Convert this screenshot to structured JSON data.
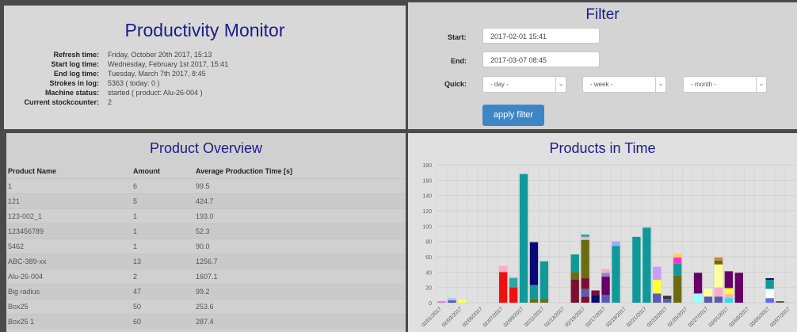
{
  "monitor": {
    "title": "Productivity Monitor",
    "rows": [
      {
        "label": "Refresh time:",
        "value": "Friday, October 20th 2017, 15:13"
      },
      {
        "label": "Start log time:",
        "value": "Wednesday, February 1st 2017, 15:41"
      },
      {
        "label": "End log time:",
        "value": "Tuesday, March 7th 2017, 8:45"
      },
      {
        "label": "Strokes in log:",
        "value": "5363 ( today: 0 )"
      },
      {
        "label": "Machine status:",
        "value": "started ( product: Alu-26-004 )"
      },
      {
        "label": "Current stockcounter:",
        "value": "2"
      }
    ]
  },
  "filter": {
    "title": "Filter",
    "start_label": "Start:",
    "start_value": "2017-02-01 15:41",
    "end_label": "End:",
    "end_value": "2017-03-07 08:45",
    "quick_label": "Quick:",
    "day": "- day -",
    "week": "- week -",
    "month": "- month -",
    "apply": "apply filter"
  },
  "products": {
    "title": "Product Overview",
    "columns": [
      "Product Name",
      "Amount",
      "Average Production Time [s]"
    ],
    "rows": [
      [
        "1",
        "6",
        "99.5"
      ],
      [
        "121",
        "5",
        "424.7"
      ],
      [
        "123-002_1",
        "1",
        "193.0"
      ],
      [
        "123456789",
        "1",
        "52.3"
      ],
      [
        "5462",
        "1",
        "90.0"
      ],
      [
        "ABC-389-xx",
        "13",
        "1256.7"
      ],
      [
        "Alu-26-004",
        "2",
        "1607.1"
      ],
      [
        "Big radius",
        "47",
        "99.2"
      ],
      [
        "Box25",
        "50",
        "253.6"
      ],
      [
        "Box25 1",
        "60",
        "287.4"
      ]
    ]
  },
  "chart_data": {
    "type": "bar",
    "stacked": true,
    "title": "Products in Time",
    "ylim": [
      0,
      180
    ],
    "yticks": [
      0,
      20,
      40,
      60,
      80,
      100,
      120,
      140,
      160,
      180
    ],
    "grid": true,
    "xticklabels": [
      "02/01/2017",
      "02/03/2017",
      "02/05/2017",
      "02/07/2017",
      "02/09/2017",
      "02/11/2017",
      "02/13/2017",
      "02/15/2017",
      "02/17/2017",
      "02/19/2017",
      "02/21/2017",
      "02/23/2017",
      "02/25/2017",
      "02/27/2017",
      "03/01/2017",
      "03/03/2017",
      "03/05/2017",
      "03/07/2017"
    ],
    "bars": [
      {
        "day": 0,
        "segments": [
          {
            "value": 2,
            "color": "#ff66ff"
          }
        ]
      },
      {
        "day": 1,
        "segments": [
          {
            "value": 3,
            "color": "#5a5ab4"
          },
          {
            "value": 3,
            "color": "#99ccff"
          }
        ]
      },
      {
        "day": 2,
        "segments": [
          {
            "value": 4,
            "color": "#ffff55"
          }
        ]
      },
      {
        "day": 6,
        "segments": [
          {
            "value": 40,
            "color": "#ee1111"
          },
          {
            "value": 8,
            "color": "#ffaacc"
          }
        ]
      },
      {
        "day": 7,
        "segments": [
          {
            "value": 20,
            "color": "#ee1111"
          },
          {
            "value": 12,
            "color": "#22aaaa"
          },
          {
            "value": 2,
            "color": "#ffaacc"
          }
        ]
      },
      {
        "day": 8,
        "segments": [
          {
            "value": 168,
            "color": "#119999"
          }
        ]
      },
      {
        "day": 9,
        "segments": [
          {
            "value": 5,
            "color": "#6b6b10"
          },
          {
            "value": 18,
            "color": "#119999"
          },
          {
            "value": 56,
            "color": "#0a0a77"
          }
        ]
      },
      {
        "day": 10,
        "segments": [
          {
            "value": 5,
            "color": "#6b6b10"
          },
          {
            "value": 49,
            "color": "#119999"
          }
        ]
      },
      {
        "day": 13,
        "segments": [
          {
            "value": 30,
            "color": "#7a1030"
          },
          {
            "value": 10,
            "color": "#6b6b10"
          },
          {
            "value": 23,
            "color": "#119999"
          }
        ]
      },
      {
        "day": 14,
        "segments": [
          {
            "value": 8,
            "color": "#7a1030"
          },
          {
            "value": 10,
            "color": "#5a5ab4"
          },
          {
            "value": 14,
            "color": "#7a1030"
          },
          {
            "value": 50,
            "color": "#6b6b10"
          },
          {
            "value": 4,
            "color": "#ffaacc"
          },
          {
            "value": 3,
            "color": "#22aaaa"
          }
        ]
      },
      {
        "day": 15,
        "segments": [
          {
            "value": 10,
            "color": "#0a0a77"
          },
          {
            "value": 6,
            "color": "#7a1030"
          }
        ]
      },
      {
        "day": 16,
        "segments": [
          {
            "value": 10,
            "color": "#5a5ab4"
          },
          {
            "value": 24,
            "color": "#660066"
          },
          {
            "value": 5,
            "color": "#8888cc"
          },
          {
            "value": 5,
            "color": "#ffaacc"
          }
        ]
      },
      {
        "day": 17,
        "segments": [
          {
            "value": 74,
            "color": "#119999"
          },
          {
            "value": 6,
            "color": "#99aaff"
          }
        ]
      },
      {
        "day": 19,
        "segments": [
          {
            "value": 86,
            "color": "#119999"
          }
        ]
      },
      {
        "day": 20,
        "segments": [
          {
            "value": 98,
            "color": "#119999"
          }
        ]
      },
      {
        "day": 21,
        "segments": [
          {
            "value": 12,
            "color": "#5a5ab4"
          },
          {
            "value": 18,
            "color": "#ffff33"
          },
          {
            "value": 17,
            "color": "#cc99ff"
          }
        ]
      },
      {
        "day": 22,
        "segments": [
          {
            "value": 5,
            "color": "#5a5ab4"
          },
          {
            "value": 4,
            "color": "#333333"
          }
        ]
      },
      {
        "day": 23,
        "segments": [
          {
            "value": 36,
            "color": "#6b6b10"
          },
          {
            "value": 15,
            "color": "#119999"
          },
          {
            "value": 8,
            "color": "#ff33cc"
          },
          {
            "value": 5,
            "color": "#ffcc66"
          }
        ]
      },
      {
        "day": 25,
        "segments": [
          {
            "value": 12,
            "color": "#99ffff"
          },
          {
            "value": 27,
            "color": "#660066"
          }
        ]
      },
      {
        "day": 26,
        "segments": [
          {
            "value": 8,
            "color": "#5a5ab4"
          },
          {
            "value": 10,
            "color": "#ffff99"
          }
        ]
      },
      {
        "day": 27,
        "segments": [
          {
            "value": 8,
            "color": "#5a5ab4"
          },
          {
            "value": 12,
            "color": "#ffaacc"
          },
          {
            "value": 30,
            "color": "#ffff99"
          },
          {
            "value": 5,
            "color": "#6b6b10"
          },
          {
            "value": 4,
            "color": "#cc8833"
          }
        ]
      },
      {
        "day": 28,
        "segments": [
          {
            "value": 6,
            "color": "#33dddd"
          },
          {
            "value": 5,
            "color": "#ffaacc"
          },
          {
            "value": 8,
            "color": "#ffff33"
          },
          {
            "value": 22,
            "color": "#660066"
          }
        ]
      },
      {
        "day": 29,
        "segments": [
          {
            "value": 39,
            "color": "#660066"
          }
        ]
      },
      {
        "day": 32,
        "segments": [
          {
            "value": 6,
            "color": "#6666ff"
          },
          {
            "value": 12,
            "color": "#ffffff"
          },
          {
            "value": 12,
            "color": "#119999"
          },
          {
            "value": 2,
            "color": "#0a0a77"
          }
        ]
      },
      {
        "day": 33,
        "segments": [
          {
            "value": 2,
            "color": "#555555"
          }
        ]
      }
    ]
  }
}
